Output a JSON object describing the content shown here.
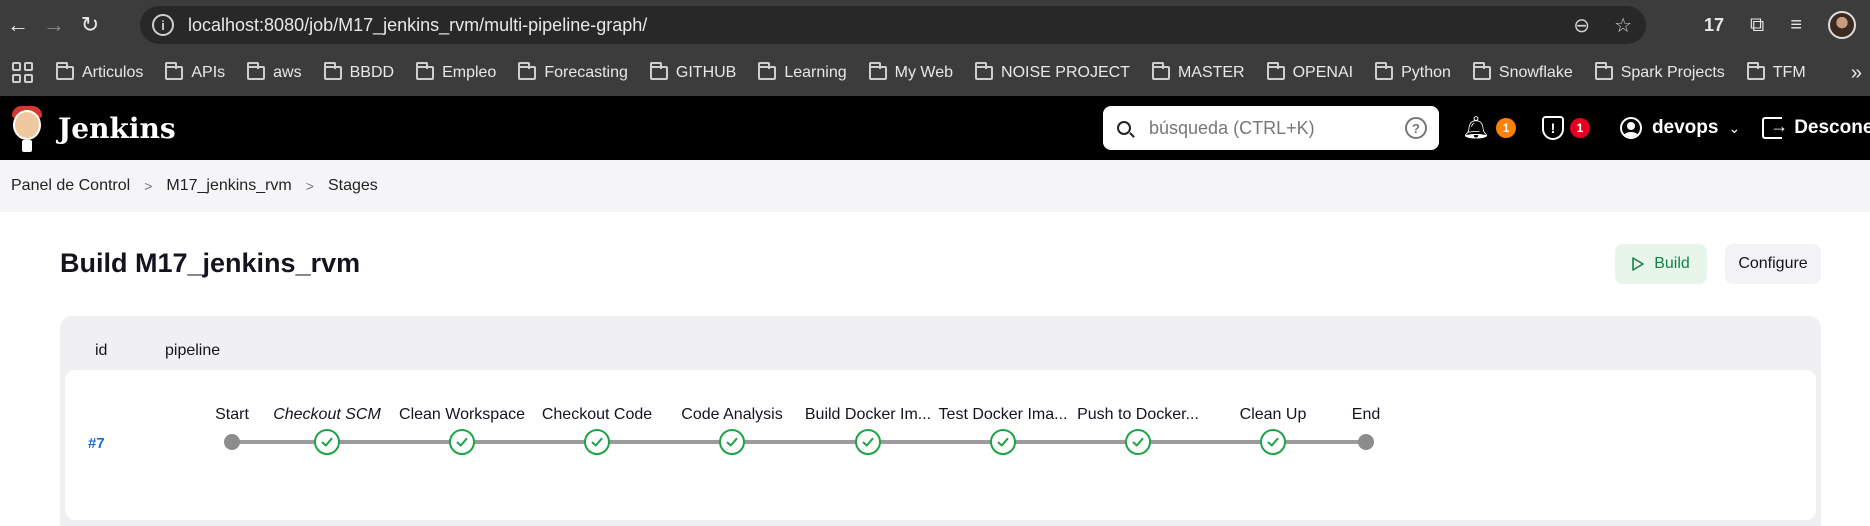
{
  "browser": {
    "url": "localhost:8080/job/M17_jenkins_rvm/multi-pipeline-graph/",
    "extension_count": "17",
    "bookmarks": [
      "Articulos",
      "APIs",
      "aws",
      "BBDD",
      "Empleo",
      "Forecasting",
      "GITHUB",
      "Learning",
      "My Web",
      "NOISE PROJECT",
      "MASTER",
      "OPENAI",
      "Python",
      "Snowflake",
      "Spark Projects",
      "TFM"
    ],
    "more_label": "»"
  },
  "header": {
    "title": "Jenkins",
    "search_placeholder": "búsqueda (CTRL+K)",
    "notifications_count": "1",
    "security_count": "1",
    "username": "devops",
    "logout_label": "Desconectar"
  },
  "breadcrumb": [
    "Panel de Control",
    "M17_jenkins_rvm",
    "Stages"
  ],
  "main": {
    "title": "Build M17_jenkins_rvm",
    "build_label": "Build",
    "configure_label": "Configure",
    "columns": [
      "id",
      "pipeline"
    ],
    "run": {
      "id": "#7",
      "stages": [
        {
          "label": "Start",
          "kind": "endpoint",
          "italic": false
        },
        {
          "label": "Checkout SCM",
          "kind": "success",
          "italic": true
        },
        {
          "label": "Clean Workspace",
          "kind": "success",
          "italic": false
        },
        {
          "label": "Checkout Code",
          "kind": "success",
          "italic": false
        },
        {
          "label": "Code Analysis",
          "kind": "success",
          "italic": false
        },
        {
          "label": "Build Docker Im...",
          "kind": "success",
          "italic": false
        },
        {
          "label": "Test Docker Ima...",
          "kind": "success",
          "italic": false
        },
        {
          "label": "Push to Docker...",
          "kind": "success",
          "italic": false
        },
        {
          "label": "Clean Up",
          "kind": "success",
          "italic": false
        },
        {
          "label": "End",
          "kind": "endpoint",
          "italic": false
        }
      ]
    }
  },
  "colors": {
    "success": "#1ea446",
    "link": "#1d6fd1",
    "badge_orange": "#fe820a",
    "badge_red": "#e6001f"
  }
}
